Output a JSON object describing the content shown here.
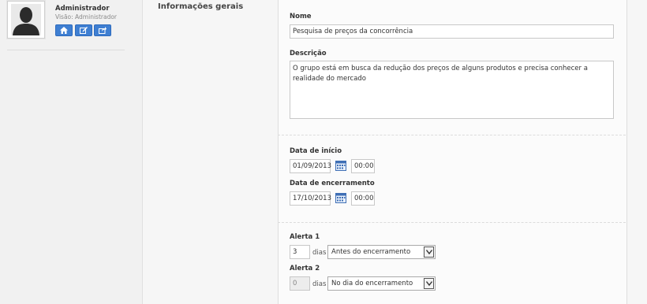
{
  "sidebar": {
    "user_name": "Administrador",
    "user_role": "Visão: Administrador",
    "buttons": [
      {
        "icon": "home-icon"
      },
      {
        "icon": "edit-icon"
      },
      {
        "icon": "share-icon"
      }
    ]
  },
  "section": {
    "title": "Informações gerais"
  },
  "form": {
    "name_label": "Nome",
    "name_value": "Pesquisa de preços da concorrência",
    "description_label": "Descrição",
    "description_value": "O grupo está em busca da redução dos preços de alguns produtos e precisa conhecer a realidade do mercado",
    "start_label": "Data de início",
    "start_date": "01/09/2013",
    "start_time": "00:00",
    "end_label": "Data de encerramento",
    "end_date": "17/10/2013",
    "end_time": "00:00",
    "alert1_label": "Alerta 1",
    "alert1_days": "3",
    "alert1_unit": "dias",
    "alert1_option": "Antes do encerramento",
    "alert2_label": "Alerta 2",
    "alert2_days": "0",
    "alert2_unit": "dias",
    "alert2_option": "No dia do encerramento"
  },
  "colors": {
    "accent": "#3f7fd2"
  }
}
